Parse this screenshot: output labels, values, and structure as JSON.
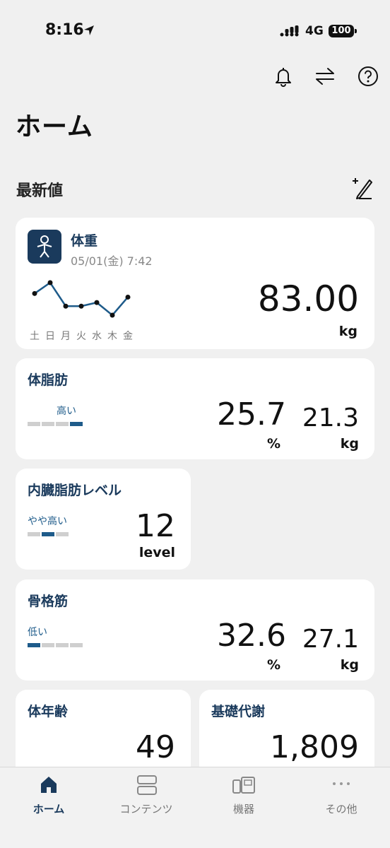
{
  "status": {
    "time": "8:16",
    "network": "4G",
    "battery": "100"
  },
  "header": {
    "title": "ホーム"
  },
  "section": {
    "title": "最新値"
  },
  "weight": {
    "title": "体重",
    "date": "05/01(金) 7:42",
    "value": "83.00",
    "unit": "kg",
    "days": [
      "土",
      "日",
      "月",
      "火",
      "水",
      "木",
      "金"
    ]
  },
  "chart_data": {
    "type": "line",
    "categories": [
      "土",
      "日",
      "月",
      "火",
      "水",
      "木",
      "金"
    ],
    "values": [
      83.2,
      83.8,
      82.5,
      82.5,
      82.7,
      82.0,
      83.0
    ]
  },
  "body_fat": {
    "title": "体脂肪",
    "level": "高い",
    "level_index": 4,
    "level_count": 4,
    "percent": "25.7",
    "percent_unit": "%",
    "kg": "21.3",
    "kg_unit": "kg"
  },
  "visceral": {
    "title": "内臓脂肪レベル",
    "level": "やや高い",
    "level_index": 2,
    "level_count": 3,
    "value": "12",
    "unit": "level"
  },
  "muscle": {
    "title": "骨格筋",
    "level": "低い",
    "level_index": 1,
    "level_count": 4,
    "percent": "32.6",
    "percent_unit": "%",
    "kg": "27.1",
    "kg_unit": "kg"
  },
  "body_age": {
    "title": "体年齢",
    "value": "49"
  },
  "bmr": {
    "title": "基礎代謝",
    "value": "1,809"
  },
  "tabs": [
    {
      "label": "ホーム",
      "icon": "home-icon",
      "active": true
    },
    {
      "label": "コンテンツ",
      "icon": "contents-icon",
      "active": false
    },
    {
      "label": "機器",
      "icon": "devices-icon",
      "active": false
    },
    {
      "label": "その他",
      "icon": "more-icon",
      "active": false
    }
  ],
  "colors": {
    "accent": "#1a3a5c",
    "bar_on": "#1e5b8a",
    "bar_off": "#cfcfcf"
  }
}
